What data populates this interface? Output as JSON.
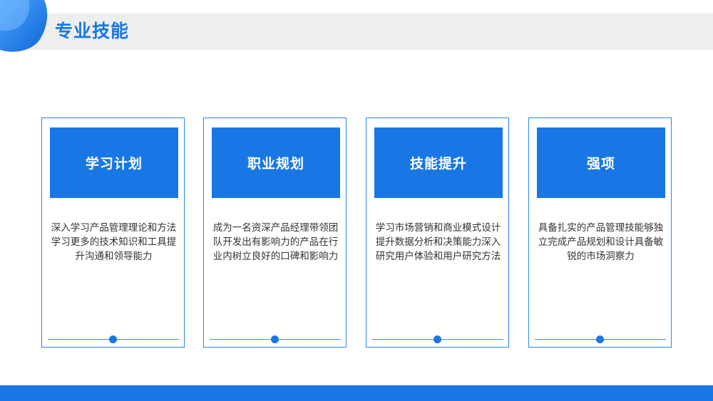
{
  "page": {
    "title": "专业技能"
  },
  "colors": {
    "accent": "#1877e5",
    "title_band": "#eeeeee",
    "card_border": "#2a86ec"
  },
  "cards": [
    {
      "heading": "学习计划",
      "text": "深入学习产品管理理论和方法学习更多的技术知识和工具提升沟通和领导能力"
    },
    {
      "heading": "职业规划",
      "text": "成为一名资深产品经理带领团队开发出有影响力的产品在行业内树立良好的口碑和影响力"
    },
    {
      "heading": "技能提升",
      "text": "学习市场营销和商业模式设计提升数据分析和决策能力深入研究用户体验和用户研究方法"
    },
    {
      "heading": "强项",
      "text": "具备扎实的产品管理技能够独立完成产品规划和设计具备敏锐的市场洞察力"
    }
  ]
}
